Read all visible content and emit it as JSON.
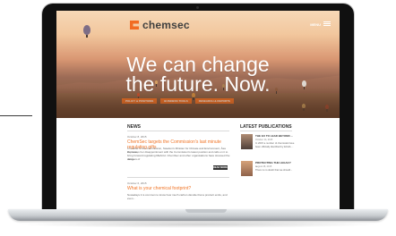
{
  "brand": {
    "name": "chemsec"
  },
  "nav": {
    "menu_label": "MENU"
  },
  "hero": {
    "headline_line1": "We can change",
    "headline_line2": "the future. Now.",
    "buttons": [
      "POLICY & POSITIONS",
      "BUSINESS TOOLS",
      "RESEARCH & REPORTS"
    ]
  },
  "news": {
    "heading": "NEWS",
    "articles": [
      {
        "date": "October 8, 2015",
        "title": "ChemSec targets the Commission's last minute regulating gifts",
        "summary_line1": "In a letter to the Commission, Sweden's Minister for Climate and Environment, Åsa Romson,",
        "summary_line2": "expresses her disappointment with the Commission's latest position and calls on it to",
        "summary_line3": "bring forward regulating REACH. ChemSec and other organisations have stressed the dangers of",
        "summary_line4": "delay...",
        "read_more": "READ MORE"
      },
      {
        "date": "October 6, 2015",
        "title": "What is your chemical footprint?",
        "summary_line1": "Nowadays it is common to know how much carbon dioxide that a product emits, and even..."
      }
    ]
  },
  "publications": {
    "heading": "LATEST PUBLICATIONS",
    "items": [
      {
        "title": "THE EU TO LEAD BEYOND ...",
        "date": "October 14, 2015",
        "summary": "In 2015 a number of chemicals have been officially identified by ECHA ..."
      },
      {
        "title": "PROTECTING THE LEGACY ...",
        "date": "August 28, 2015",
        "summary": "There is no doubt that we should..."
      }
    ]
  },
  "colors": {
    "accent": "#f37021",
    "text_dark": "#333333"
  }
}
